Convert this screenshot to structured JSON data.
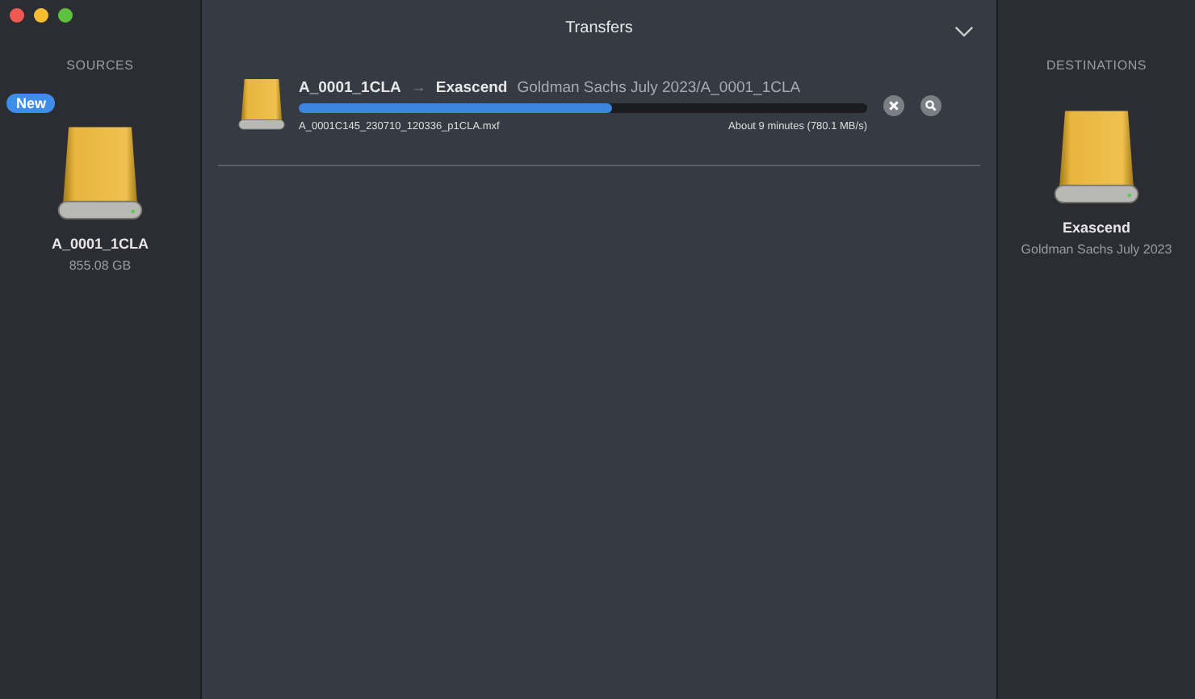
{
  "window": {
    "title": "Transfers"
  },
  "sources": {
    "heading": "SOURCES",
    "items": [
      {
        "badge": "New",
        "name": "A_0001_1CLA",
        "size": "855.08 GB"
      }
    ]
  },
  "transfers": [
    {
      "source": "A_0001_1CLA",
      "arrow": "→",
      "destination": "Exascend",
      "path": "Goldman Sachs July 2023/A_0001_1CLA",
      "level": 0.55,
      "file": "A_0001C145_230710_120336_p1CLA.mxf",
      "remaining": "About 9 minutes (780.1 MB/s)"
    }
  ],
  "destinations": {
    "heading": "DESTINATIONS",
    "items": [
      {
        "name": "Exascend",
        "subtitle": "Goldman Sachs July 2023"
      }
    ]
  }
}
